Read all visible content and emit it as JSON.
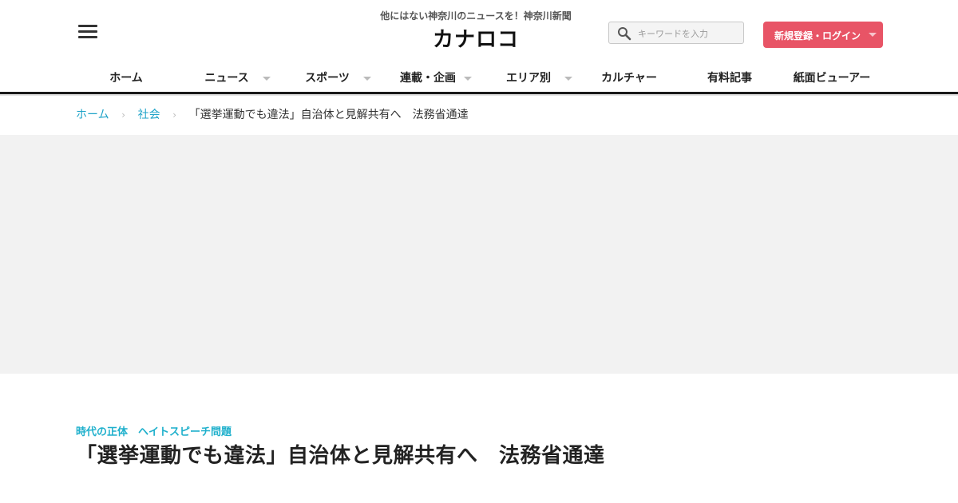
{
  "header": {
    "tagline": "他にはない神奈川のニュースを！神奈川新聞",
    "logo": "カナロコ",
    "search_placeholder": "キーワードを入力",
    "login_label": "新規登録・ログイン",
    "login_color": "#e85466"
  },
  "nav": {
    "items": [
      {
        "label": "ホーム",
        "dropdown": false
      },
      {
        "label": "ニュース",
        "dropdown": true
      },
      {
        "label": "スポーツ",
        "dropdown": true
      },
      {
        "label": "連載・企画",
        "dropdown": true
      },
      {
        "label": "エリア別",
        "dropdown": true
      },
      {
        "label": "カルチャー",
        "dropdown": false
      },
      {
        "label": "有料記事",
        "dropdown": false
      },
      {
        "label": "紙面ビューアー",
        "dropdown": false
      }
    ]
  },
  "breadcrumb": {
    "home": "ホーム",
    "section": "社会",
    "current": "「選挙運動でも違法」自治体と見解共有へ　法務省通達"
  },
  "article": {
    "category": "時代の正体　ヘイトスピーチ問題",
    "title": "「選挙運動でも違法」自治体と見解共有へ　法務省通達"
  },
  "colors": {
    "accent_link": "#1fa3c8",
    "category": "#1fb0cc"
  }
}
